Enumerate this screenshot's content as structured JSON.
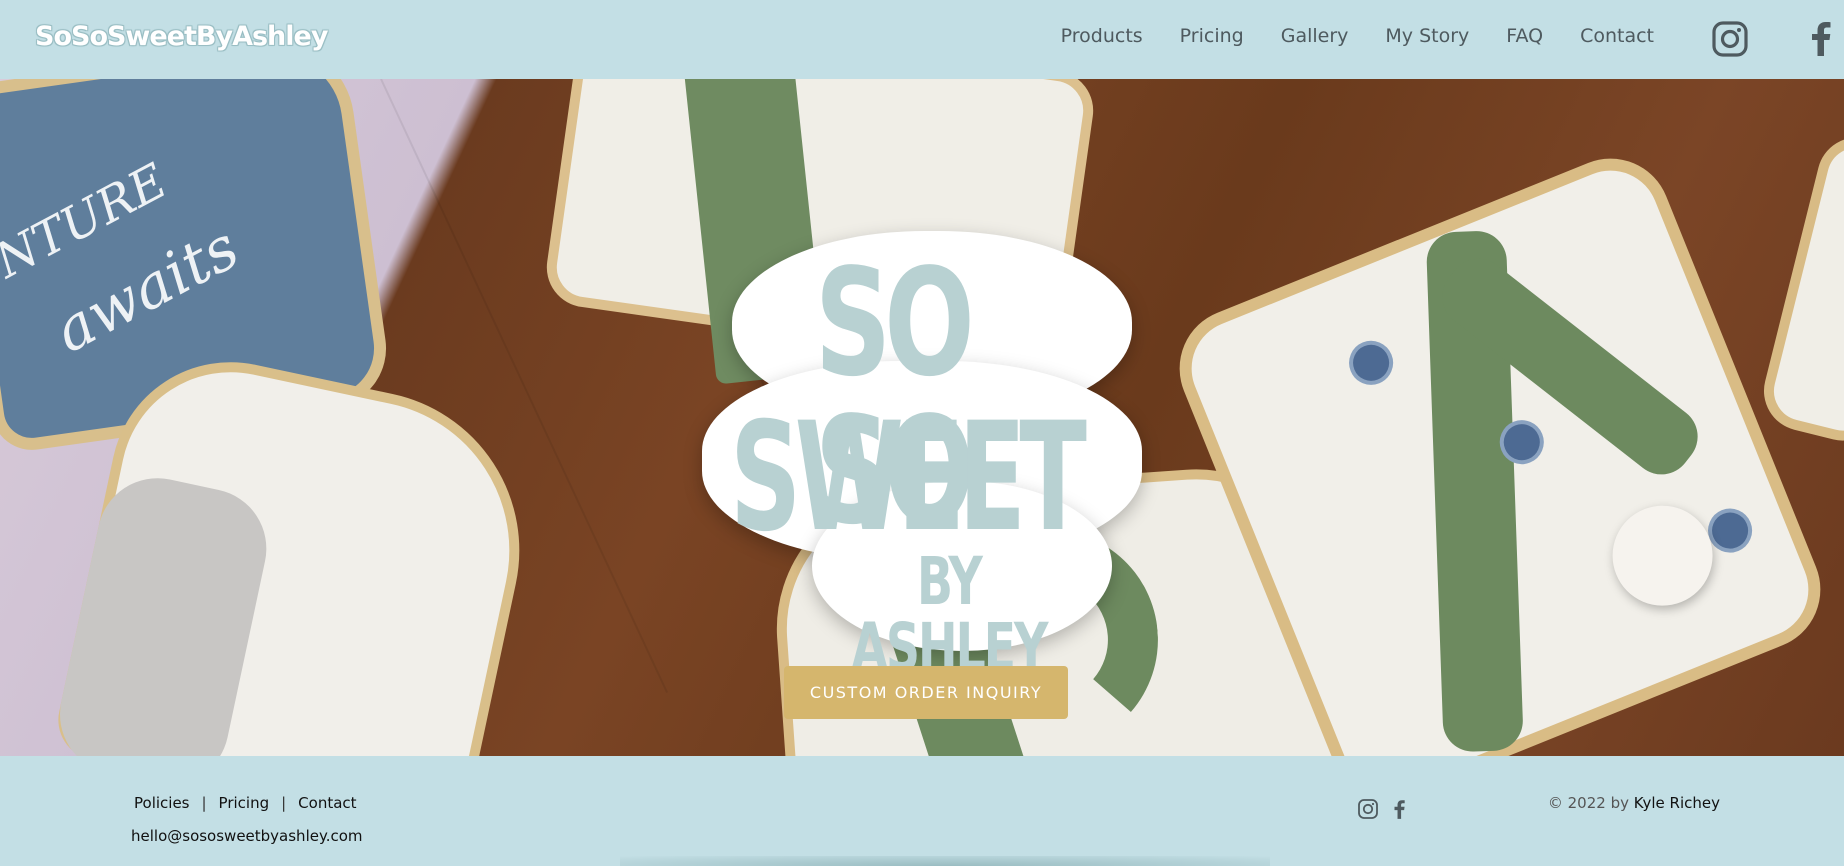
{
  "header": {
    "brand": "SoSoSweetByAshley",
    "nav": [
      "Products",
      "Pricing",
      "Gallery",
      "My Story",
      "FAQ",
      "Contact"
    ],
    "social_icons": [
      "instagram-icon",
      "facebook-icon"
    ]
  },
  "hero": {
    "logo": {
      "line1": "SO SO",
      "line2": "SWEET",
      "line3": "BY ASHLEY"
    },
    "cookie_text": {
      "line1": "NTURE",
      "line2": "awaits"
    },
    "cta_label": "CUSTOM ORDER INQUIRY"
  },
  "footer": {
    "links": [
      "Policies",
      "Pricing",
      "Contact"
    ],
    "separator": "|",
    "email": "hello@sososweetbyashley.com",
    "copyright_prefix": "© 2022 by",
    "copyright_owner": "Kyle Richey",
    "social_icons": [
      "instagram-icon",
      "facebook-icon"
    ]
  },
  "colors": {
    "header_bg": "#c3dfe5",
    "nav_text": "#4e5a5f",
    "cta_bg": "#d5b66d",
    "logo_text": "#b8d1d2"
  }
}
